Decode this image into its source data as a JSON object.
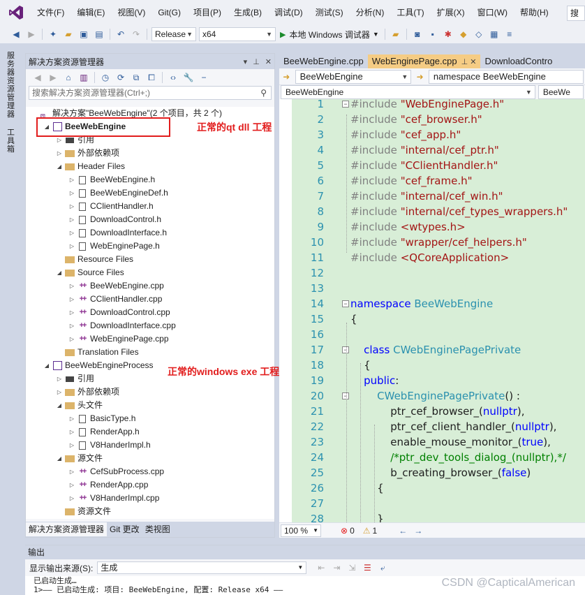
{
  "menu": [
    "文件(F)",
    "编辑(E)",
    "视图(V)",
    "Git(G)",
    "项目(P)",
    "生成(B)",
    "调试(D)",
    "测试(S)",
    "分析(N)",
    "工具(T)",
    "扩展(X)",
    "窗口(W)",
    "帮助(H)"
  ],
  "search_label": "搜",
  "toolbar": {
    "config": "Release",
    "platform": "x64",
    "run_label": "本地 Windows 调试器"
  },
  "side_tabs": {
    "server_explorer": "服务器资源管理器",
    "toolbox": "工具箱"
  },
  "solution_explorer": {
    "title": "解决方案资源管理器",
    "search_placeholder": "搜索解决方案资源管理器(Ctrl+;)",
    "tree": [
      {
        "label": "解决方案\"BeeWebEngine\"(2 个项目，共 2 个)",
        "icon": "solution-icon",
        "indent": 0,
        "arrow": ""
      },
      {
        "label": "BeeWebEngine",
        "icon": "project-icon",
        "indent": 1,
        "arrow": "◢",
        "bold": true
      },
      {
        "label": "引用",
        "icon": "reference-icon",
        "indent": 2,
        "arrow": "▷"
      },
      {
        "label": "外部依赖项",
        "icon": "external-deps-icon",
        "indent": 2,
        "arrow": "▷"
      },
      {
        "label": "Header Files",
        "icon": "folder-filter-icon",
        "indent": 2,
        "arrow": "◢"
      },
      {
        "label": "BeeWebEngine.h",
        "icon": "header-file-icon",
        "indent": 3,
        "arrow": "▷"
      },
      {
        "label": "BeeWebEngineDef.h",
        "icon": "header-file-icon",
        "indent": 3,
        "arrow": "▷"
      },
      {
        "label": "CClientHandler.h",
        "icon": "header-file-icon",
        "indent": 3,
        "arrow": "▷"
      },
      {
        "label": "DownloadControl.h",
        "icon": "header-file-icon",
        "indent": 3,
        "arrow": "▷"
      },
      {
        "label": "DownloadInterface.h",
        "icon": "header-file-icon",
        "indent": 3,
        "arrow": "▷"
      },
      {
        "label": "WebEnginePage.h",
        "icon": "header-file-icon",
        "indent": 3,
        "arrow": "▷"
      },
      {
        "label": "Resource Files",
        "icon": "folder-filter-icon",
        "indent": 2,
        "arrow": ""
      },
      {
        "label": "Source Files",
        "icon": "folder-filter-icon",
        "indent": 2,
        "arrow": "◢"
      },
      {
        "label": "BeeWebEngine.cpp",
        "icon": "cpp-file-icon",
        "indent": 3,
        "arrow": "▷"
      },
      {
        "label": "CClientHandler.cpp",
        "icon": "cpp-file-icon",
        "indent": 3,
        "arrow": "▷"
      },
      {
        "label": "DownloadControl.cpp",
        "icon": "cpp-file-icon",
        "indent": 3,
        "arrow": "▷"
      },
      {
        "label": "DownloadInterface.cpp",
        "icon": "cpp-file-icon",
        "indent": 3,
        "arrow": "▷"
      },
      {
        "label": "WebEnginePage.cpp",
        "icon": "cpp-file-icon",
        "indent": 3,
        "arrow": "▷"
      },
      {
        "label": "Translation Files",
        "icon": "folder-filter-icon",
        "indent": 2,
        "arrow": ""
      },
      {
        "label": "BeeWebEngineProcess",
        "icon": "project-icon",
        "indent": 1,
        "arrow": "◢"
      },
      {
        "label": "引用",
        "icon": "reference-icon",
        "indent": 2,
        "arrow": "▷"
      },
      {
        "label": "外部依赖项",
        "icon": "external-deps-icon",
        "indent": 2,
        "arrow": "▷"
      },
      {
        "label": "头文件",
        "icon": "folder-filter-icon",
        "indent": 2,
        "arrow": "◢"
      },
      {
        "label": "BasicType.h",
        "icon": "header-file-icon",
        "indent": 3,
        "arrow": "▷"
      },
      {
        "label": "RenderApp.h",
        "icon": "header-file-icon",
        "indent": 3,
        "arrow": "▷"
      },
      {
        "label": "V8HanderImpl.h",
        "icon": "header-file-icon",
        "indent": 3,
        "arrow": "▷"
      },
      {
        "label": "源文件",
        "icon": "folder-filter-icon",
        "indent": 2,
        "arrow": "◢"
      },
      {
        "label": "CefSubProcess.cpp",
        "icon": "cpp-file-icon",
        "indent": 3,
        "arrow": "▷"
      },
      {
        "label": "RenderApp.cpp",
        "icon": "cpp-file-icon",
        "indent": 3,
        "arrow": "▷"
      },
      {
        "label": "V8HanderImpl.cpp",
        "icon": "cpp-file-icon",
        "indent": 3,
        "arrow": "▷"
      },
      {
        "label": "资源文件",
        "icon": "folder-filter-icon",
        "indent": 2,
        "arrow": ""
      }
    ],
    "annotation_qt": "正常的qt dll 工程",
    "annotation_exe": "正常的windows exe 工程",
    "bottom_tabs": [
      "解决方案资源管理器",
      "Git 更改",
      "类视图"
    ]
  },
  "editor": {
    "tabs": [
      {
        "label": "BeeWebEngine.cpp",
        "active": false
      },
      {
        "label": "WebEnginePage.cpp",
        "active": true
      },
      {
        "label": "DownloadContro",
        "active": false
      }
    ],
    "nav_project": "BeeWebEngine",
    "nav_scope": "namespace BeeWebEngine",
    "nav2_left": "BeeWebEngine",
    "nav2_right": "BeeWe",
    "zoom": "100 %",
    "errors": "0",
    "warnings": "1",
    "code": [
      [
        [
          "pp",
          "#include "
        ],
        [
          "str",
          "\"WebEnginePage.h\""
        ]
      ],
      [
        [
          "pp",
          "#include "
        ],
        [
          "str",
          "\"cef_browser.h\""
        ]
      ],
      [
        [
          "pp",
          "#include "
        ],
        [
          "str",
          "\"cef_app.h\""
        ]
      ],
      [
        [
          "pp",
          "#include "
        ],
        [
          "str",
          "\"internal/cef_ptr.h\""
        ]
      ],
      [
        [
          "pp",
          "#include "
        ],
        [
          "str",
          "\"CClientHandler.h\""
        ]
      ],
      [
        [
          "pp",
          "#include "
        ],
        [
          "str",
          "\"cef_frame.h\""
        ]
      ],
      [
        [
          "pp",
          "#include "
        ],
        [
          "str",
          "\"internal/cef_win.h\""
        ]
      ],
      [
        [
          "pp",
          "#include "
        ],
        [
          "str",
          "\"internal/cef_types_wrappers.h\""
        ]
      ],
      [
        [
          "pp",
          "#include "
        ],
        [
          "str",
          "<wtypes.h>"
        ]
      ],
      [
        [
          "pp",
          "#include "
        ],
        [
          "str",
          "\"wrapper/cef_helpers.h\""
        ]
      ],
      [
        [
          "pp",
          "#include "
        ],
        [
          "str",
          "<QCoreApplication>"
        ]
      ],
      [],
      [],
      [
        [
          "kw",
          "namespace "
        ],
        [
          "ns",
          "BeeWebEngine"
        ]
      ],
      [
        [
          "fn",
          "{"
        ]
      ],
      [],
      [
        [
          "fn",
          "    "
        ],
        [
          "kw",
          "class "
        ],
        [
          "ns",
          "CWebEnginePagePrivate"
        ]
      ],
      [
        [
          "fn",
          "    {"
        ]
      ],
      [
        [
          "fn",
          "    "
        ],
        [
          "kw",
          "public"
        ],
        [
          "fn",
          ":"
        ]
      ],
      [
        [
          "fn",
          "        "
        ],
        [
          "ns",
          "CWebEnginePagePrivate"
        ],
        [
          "fn",
          "() :"
        ]
      ],
      [
        [
          "fn",
          "            ptr_cef_browser_("
        ],
        [
          "kw",
          "nullptr"
        ],
        [
          "fn",
          "),"
        ]
      ],
      [
        [
          "fn",
          "            ptr_cef_client_handler_("
        ],
        [
          "kw",
          "nullptr"
        ],
        [
          "fn",
          "),"
        ]
      ],
      [
        [
          "fn",
          "            enable_mouse_monitor_("
        ],
        [
          "kw",
          "true"
        ],
        [
          "fn",
          "),"
        ]
      ],
      [
        [
          "fn",
          "            "
        ],
        [
          "cm",
          "/*ptr_dev_tools_dialog_(nullptr),*/"
        ]
      ],
      [
        [
          "fn",
          "            b_creating_browser_("
        ],
        [
          "kw",
          "false"
        ],
        [
          "fn",
          ")"
        ]
      ],
      [
        [
          "fn",
          "        {"
        ]
      ],
      [],
      [
        [
          "fn",
          "        }"
        ]
      ]
    ]
  },
  "output": {
    "title": "输出",
    "source_label": "显示输出来源(S):",
    "source_value": "生成",
    "lines": [
      "已启动生成…",
      "1>—— 已启动生成: 项目: BeeWebEngine, 配置: Release x64 ——"
    ]
  },
  "watermark": "CSDN @CapticalAmerican"
}
